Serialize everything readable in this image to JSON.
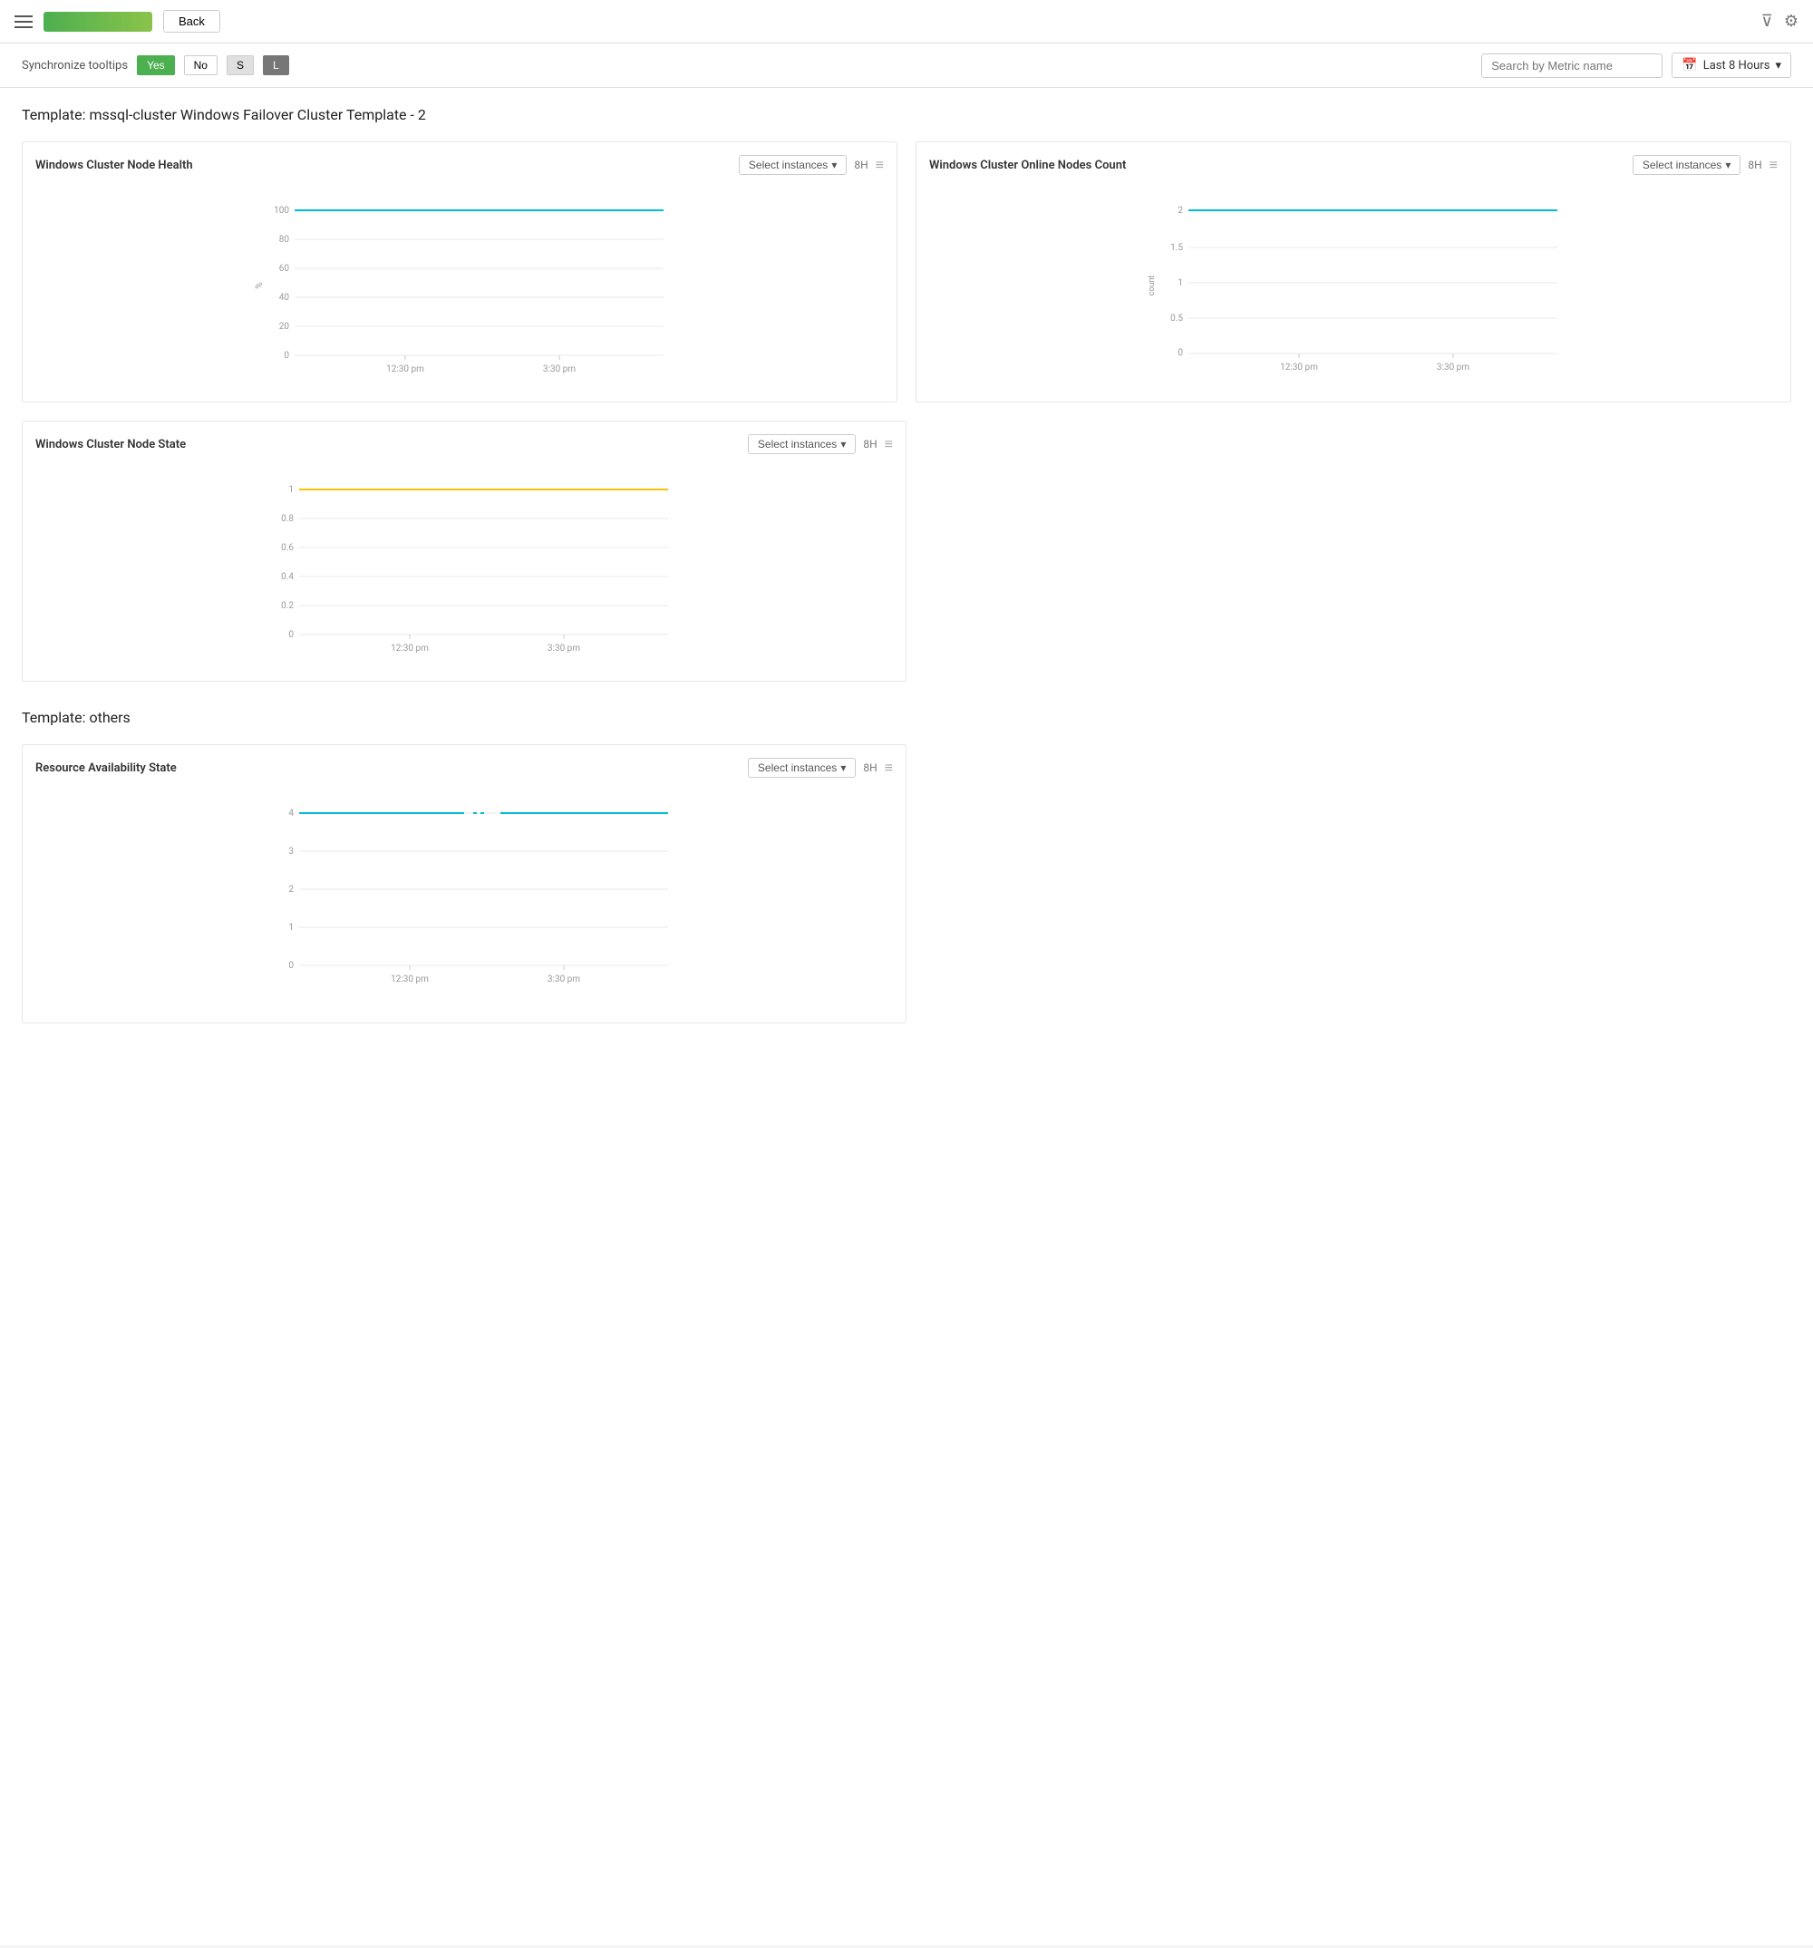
{
  "nav": {
    "back_label": "Back",
    "logo_alt": "Logo"
  },
  "toolbar": {
    "sync_tooltips_label": "Synchronize tooltips",
    "yes_label": "Yes",
    "no_label": "No",
    "size_s": "S",
    "size_l": "L",
    "search_placeholder": "Search by Metric name",
    "time_selector": "Last 8 Hours"
  },
  "sections": [
    {
      "id": "section1",
      "template_prefix": "Template:",
      "template_name": "mssql-cluster Windows Failover Cluster Template - 2",
      "charts": [
        {
          "id": "chart1",
          "title": "Windows Cluster Node Health",
          "select_label": "Select instances",
          "period": "8H",
          "y_axis_label": "%",
          "y_ticks": [
            "100",
            "80",
            "60",
            "40",
            "20",
            "0"
          ],
          "x_ticks": [
            "12:30 pm",
            "3:30 pm"
          ],
          "line_color": "cyan",
          "line_value_pct": 95
        },
        {
          "id": "chart2",
          "title": "Windows Cluster Online Nodes Count",
          "select_label": "Select instances",
          "period": "8H",
          "y_axis_label": "count",
          "y_ticks": [
            "2",
            "1.5",
            "1",
            "0.5",
            "0"
          ],
          "x_ticks": [
            "12:30 pm",
            "3:30 pm"
          ],
          "line_color": "cyan",
          "line_value_pct": 100
        }
      ]
    },
    {
      "id": "section1b",
      "charts_single": [
        {
          "id": "chart3",
          "title": "Windows Cluster Node State",
          "select_label": "Select instances",
          "period": "8H",
          "y_axis_label": "",
          "y_ticks": [
            "1",
            "0.8",
            "0.6",
            "0.4",
            "0.2",
            "0"
          ],
          "x_ticks": [
            "12:30 pm",
            "3:30 pm"
          ],
          "line_color": "yellow",
          "line_value_pct": 100
        }
      ]
    }
  ],
  "sections2": [
    {
      "id": "section2",
      "template_prefix": "Template:",
      "template_name": "others",
      "charts": [
        {
          "id": "chart4",
          "title": "Resource Availability State",
          "select_label": "Select instances",
          "period": "8H",
          "y_axis_label": "",
          "y_ticks": [
            "4",
            "3",
            "2",
            "1",
            "0"
          ],
          "x_ticks": [
            "12:30 pm",
            "3:30 pm"
          ],
          "line_color": "cyan",
          "line_value_pct": 100
        }
      ]
    }
  ]
}
